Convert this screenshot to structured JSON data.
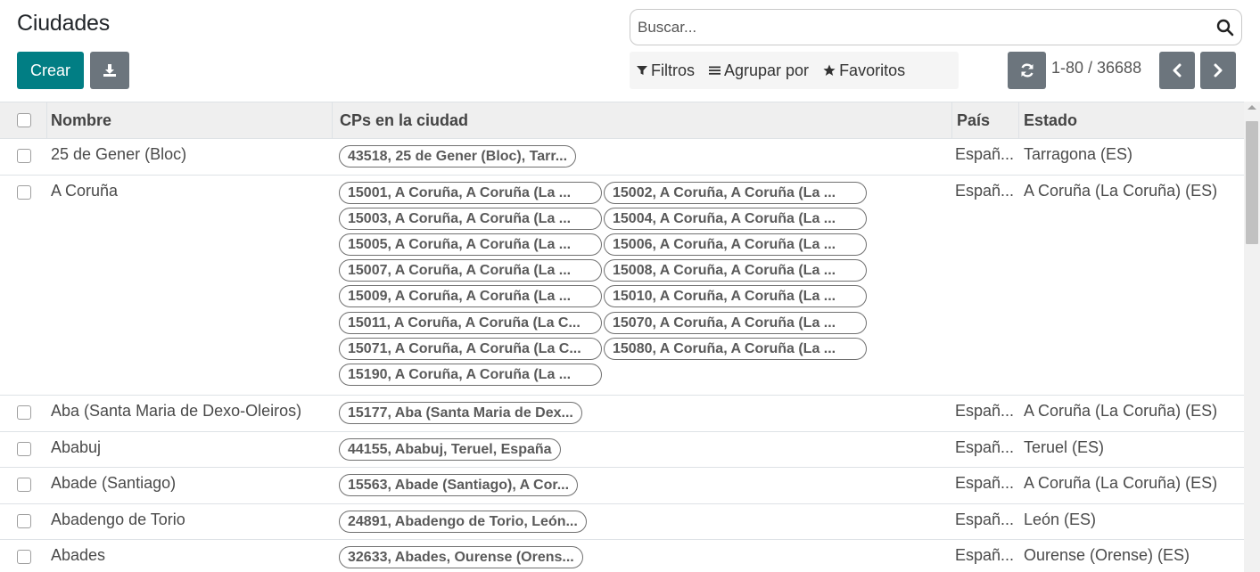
{
  "header": {
    "title": "Ciudades",
    "create_label": "Crear"
  },
  "search": {
    "placeholder": "Buscar..."
  },
  "facets": {
    "filters": "Filtros",
    "group_by": "Agrupar por",
    "favorites": "Favoritos"
  },
  "pager": {
    "range": "1-80 / 36688"
  },
  "table": {
    "columns": {
      "name": "Nombre",
      "zips": "CPs en la ciudad",
      "country": "País",
      "state": "Estado"
    },
    "rows": [
      {
        "name": "25 de Gener (Bloc)",
        "country": "Españ...",
        "state": "Tarragona (ES)",
        "tags": [
          "43518, 25 de Gener (Bloc), Tarr..."
        ]
      },
      {
        "name": "A Coruña",
        "country": "Españ...",
        "state": "A Coruña (La Coruña) (ES)",
        "tags": [
          "15001, A Coruña, A Coruña (La ...",
          "15002, A Coruña, A Coruña (La ...",
          "15003, A Coruña, A Coruña (La ...",
          "15004, A Coruña, A Coruña (La ...",
          "15005, A Coruña, A Coruña (La ...",
          "15006, A Coruña, A Coruña (La ...",
          "15007, A Coruña, A Coruña (La ...",
          "15008, A Coruña, A Coruña (La ...",
          "15009, A Coruña, A Coruña (La ...",
          "15010, A Coruña, A Coruña (La ...",
          "15011, A Coruña, A Coruña (La C...",
          "15070, A Coruña, A Coruña (La ...",
          "15071, A Coruña, A Coruña (La C...",
          "15080, A Coruña, A Coruña (La ...",
          "15190, A Coruña, A Coruña (La ..."
        ]
      },
      {
        "name": "Aba (Santa Maria de Dexo-Oleiros)",
        "country": "Españ...",
        "state": "A Coruña (La Coruña) (ES)",
        "tags": [
          "15177, Aba (Santa Maria de Dex..."
        ]
      },
      {
        "name": "Ababuj",
        "country": "Españ...",
        "state": "Teruel (ES)",
        "tags": [
          "44155, Ababuj, Teruel, España"
        ]
      },
      {
        "name": "Abade (Santiago)",
        "country": "Españ...",
        "state": "A Coruña (La Coruña) (ES)",
        "tags": [
          "15563, Abade (Santiago), A Cor..."
        ]
      },
      {
        "name": "Abadengo de Torio",
        "country": "Españ...",
        "state": "León (ES)",
        "tags": [
          "24891, Abadengo de Torio, León..."
        ]
      },
      {
        "name": "Abades",
        "country": "Españ...",
        "state": "Ourense (Orense) (ES)",
        "tags": [
          "32633, Abades, Ourense (Orens..."
        ]
      }
    ]
  },
  "icons": {
    "download": "download-icon",
    "search": "search-icon",
    "filter": "filter-icon",
    "group": "list-icon",
    "favorite": "star-icon",
    "refresh": "refresh-icon",
    "prev": "chevron-left-icon",
    "next": "chevron-right-icon"
  },
  "colors": {
    "primary": "#017e84",
    "secondary": "#6c757d"
  }
}
